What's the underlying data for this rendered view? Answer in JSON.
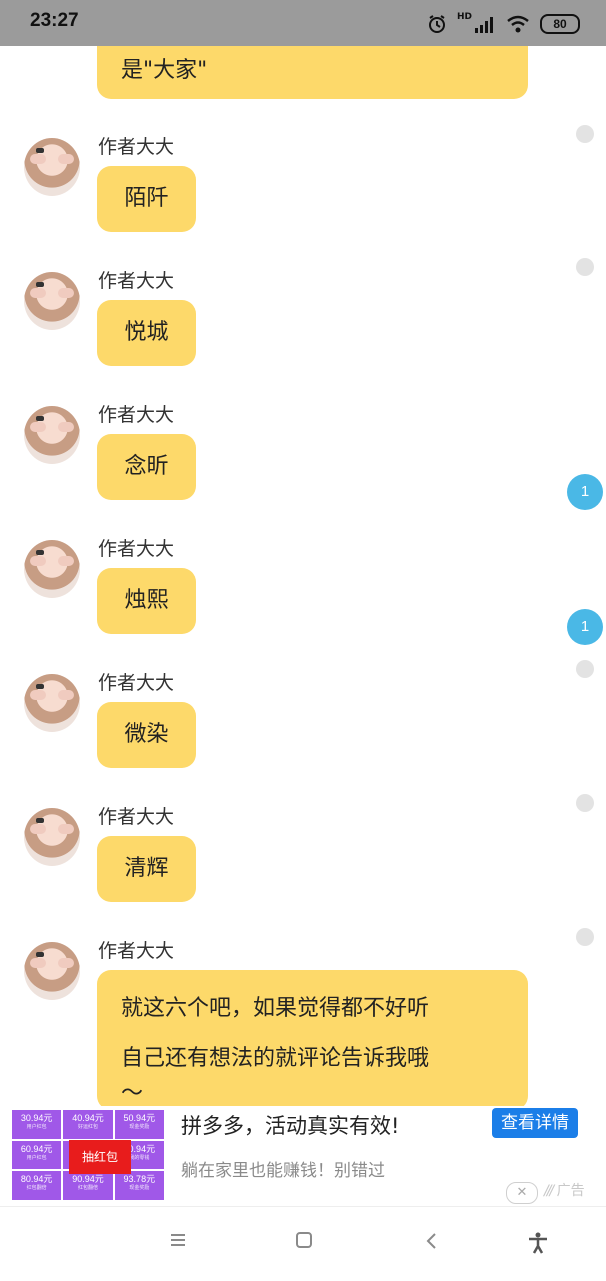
{
  "status_bar": {
    "time": "23:27",
    "battery": "80",
    "network": "HD"
  },
  "chat": {
    "partial_message": "是\"大家\"",
    "messages": [
      {
        "sender": "作者大大",
        "text": "陌阡"
      },
      {
        "sender": "作者大大",
        "text": "悦城"
      },
      {
        "sender": "作者大大",
        "text": "念昕"
      },
      {
        "sender": "作者大大",
        "text": "烛熙"
      },
      {
        "sender": "作者大大",
        "text": "微染"
      },
      {
        "sender": "作者大大",
        "text": "清辉"
      },
      {
        "sender": "作者大大",
        "lines": [
          "就这六个吧，如果觉得都不好听",
          "自己还有想法的就评论告诉我哦",
          "～"
        ]
      }
    ],
    "badges": [
      "1",
      "1"
    ]
  },
  "ad": {
    "title": "拼多多，活动真实有效!",
    "subtitle": "躺在家里也能赚钱！别错过",
    "button": "查看详情",
    "tag": "广告",
    "grid": [
      {
        "value": "30.94元",
        "label": "用户红包"
      },
      {
        "value": "40.94元",
        "label": "好运红包"
      },
      {
        "value": "50.94元",
        "label": "现金奖励"
      },
      {
        "value": "60.94元",
        "label": "用户红包"
      },
      {
        "value": "",
        "label": ""
      },
      {
        "value": "70.94元",
        "label": "我的零钱"
      },
      {
        "value": "80.94元",
        "label": "红包翻倍"
      },
      {
        "value": "90.94元",
        "label": "红包翻倍"
      },
      {
        "value": "93.78元",
        "label": "现金奖励"
      }
    ],
    "center": "抽红包"
  },
  "colors": {
    "bubble": "#fdd96a",
    "badge": "#4ab8e6",
    "ad_button": "#1b7ee8"
  }
}
